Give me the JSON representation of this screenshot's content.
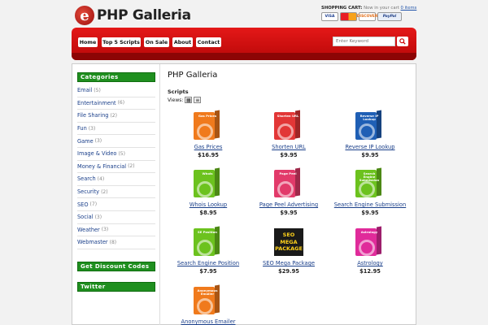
{
  "header": {
    "logo_letter": "e",
    "site_name": "PHP Galleria",
    "cart_label": "SHOPPING CART:",
    "cart_status": "Now in your cart",
    "cart_items": "0 items",
    "payment_cards": [
      "VISA",
      "MasterCard",
      "DISCOVER",
      "PayPal"
    ]
  },
  "nav": {
    "items": [
      "Home",
      "Top 5 Scripts",
      "On Sale",
      "About",
      "Contact"
    ],
    "search_placeholder": "Enter Keyword",
    "search_icon": "magnifier-icon"
  },
  "sidebar": {
    "categories_title": "Categories",
    "categories": [
      {
        "label": "Email",
        "count": "(5)"
      },
      {
        "label": "Entertainment",
        "count": "(6)"
      },
      {
        "label": "File Sharing",
        "count": "(2)"
      },
      {
        "label": "Fun",
        "count": "(3)"
      },
      {
        "label": "Game",
        "count": "(3)"
      },
      {
        "label": "Image & Video",
        "count": "(5)"
      },
      {
        "label": "Money & Financial",
        "count": "(2)"
      },
      {
        "label": "Search",
        "count": "(4)"
      },
      {
        "label": "Security",
        "count": "(2)"
      },
      {
        "label": "SEO",
        "count": "(7)"
      },
      {
        "label": "Social",
        "count": "(3)"
      },
      {
        "label": "Weather",
        "count": "(3)"
      },
      {
        "label": "Webmaster",
        "count": "(8)"
      }
    ],
    "discount_title": "Get Discount Codes",
    "twitter_title": "Twitter"
  },
  "content": {
    "title": "PHP Galleria",
    "section_label": "Scripts",
    "views_label": "Views:",
    "products": [
      {
        "name": "Gas Prices",
        "price": "$16.95",
        "box_label": "Gas Prices",
        "color": "#f07a1c"
      },
      {
        "name": "Shorten URL",
        "price": "$9.95",
        "box_label": "Shorten URL",
        "color": "#e23636"
      },
      {
        "name": "Reverse IP Lookup",
        "price": "$9.95",
        "box_label": "Reverse IP Lookup",
        "color": "#1f5fb5"
      },
      {
        "name": "Whois Lookup",
        "price": "$8.95",
        "box_label": "Whois",
        "color": "#6cc21e"
      },
      {
        "name": "Page Peel Advertising",
        "price": "$9.95",
        "box_label": "Page Peel",
        "color": "#e23a6a"
      },
      {
        "name": "Search Engine Submission",
        "price": "$9.95",
        "box_label": "Search Engine Submission",
        "color": "#6cc21e"
      },
      {
        "name": "Search Engine Position",
        "price": "$7.95",
        "box_label": "SE Position",
        "color": "#6cc21e"
      },
      {
        "name": "SEO Mega Package",
        "price": "$29.95",
        "box_label": "SEO MEGA PACKAGE",
        "color": "#1a1a1a"
      },
      {
        "name": "Astrology",
        "price": "$12.95",
        "box_label": "Astrology",
        "color": "#e02b9a"
      },
      {
        "name": "Anonymous Emailer",
        "price": "",
        "box_label": "Anonymous Emailer",
        "color": "#f07a1c"
      }
    ]
  }
}
